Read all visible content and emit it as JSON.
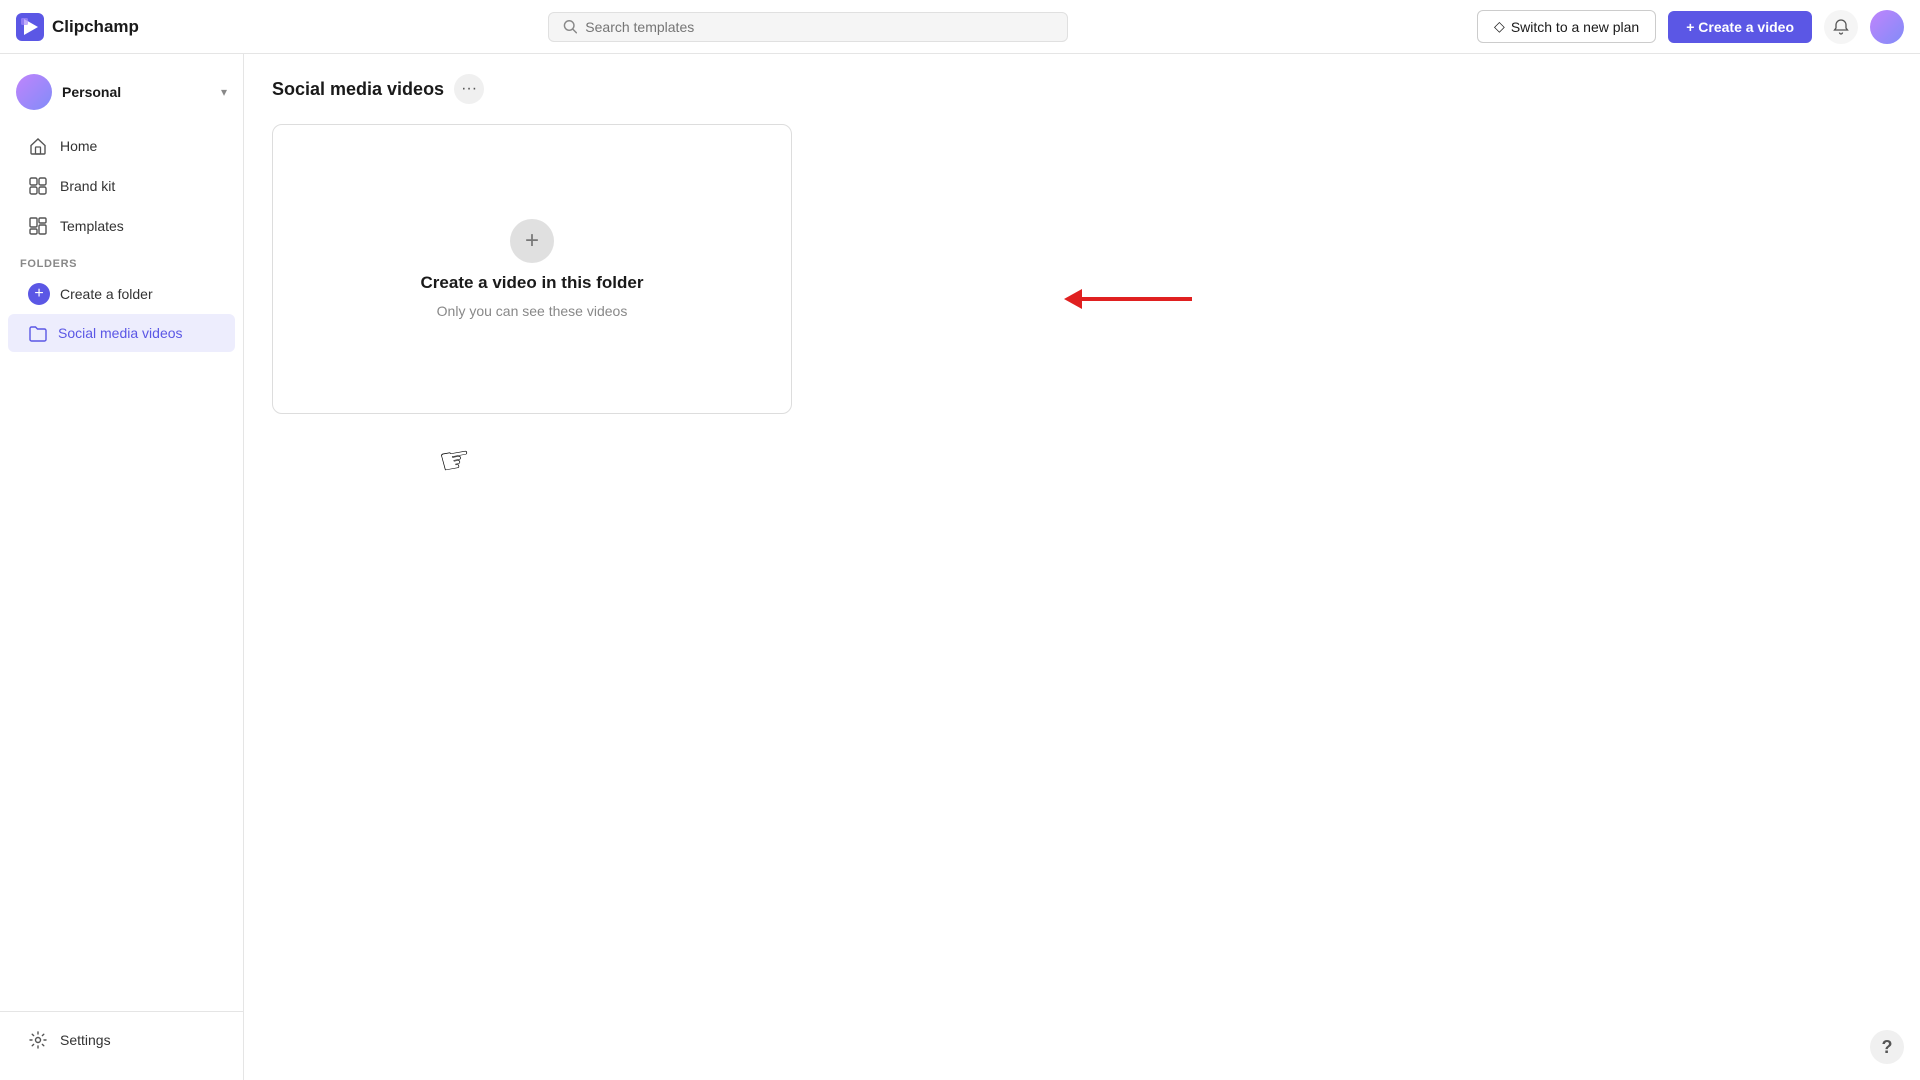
{
  "app": {
    "name": "Clipchamp"
  },
  "topbar": {
    "search_placeholder": "Search templates",
    "switch_plan_label": "Switch to a new plan",
    "create_video_label": "+ Create a video",
    "diamond_icon": "◇"
  },
  "sidebar": {
    "user": {
      "name": "Personal"
    },
    "nav_items": [
      {
        "id": "home",
        "label": "Home"
      },
      {
        "id": "brand-kit",
        "label": "Brand kit"
      },
      {
        "id": "templates",
        "label": "Templates"
      }
    ],
    "folders_label": "FOLDERS",
    "create_folder_label": "Create a folder",
    "folder_items": [
      {
        "id": "social-media-videos",
        "label": "Social media videos",
        "active": true
      }
    ],
    "settings_label": "Settings"
  },
  "content": {
    "folder_title": "Social media videos",
    "more_icon": "•••",
    "empty_card": {
      "title": "Create a video in this folder",
      "subtitle": "Only you can see these videos"
    }
  },
  "help_label": "?"
}
